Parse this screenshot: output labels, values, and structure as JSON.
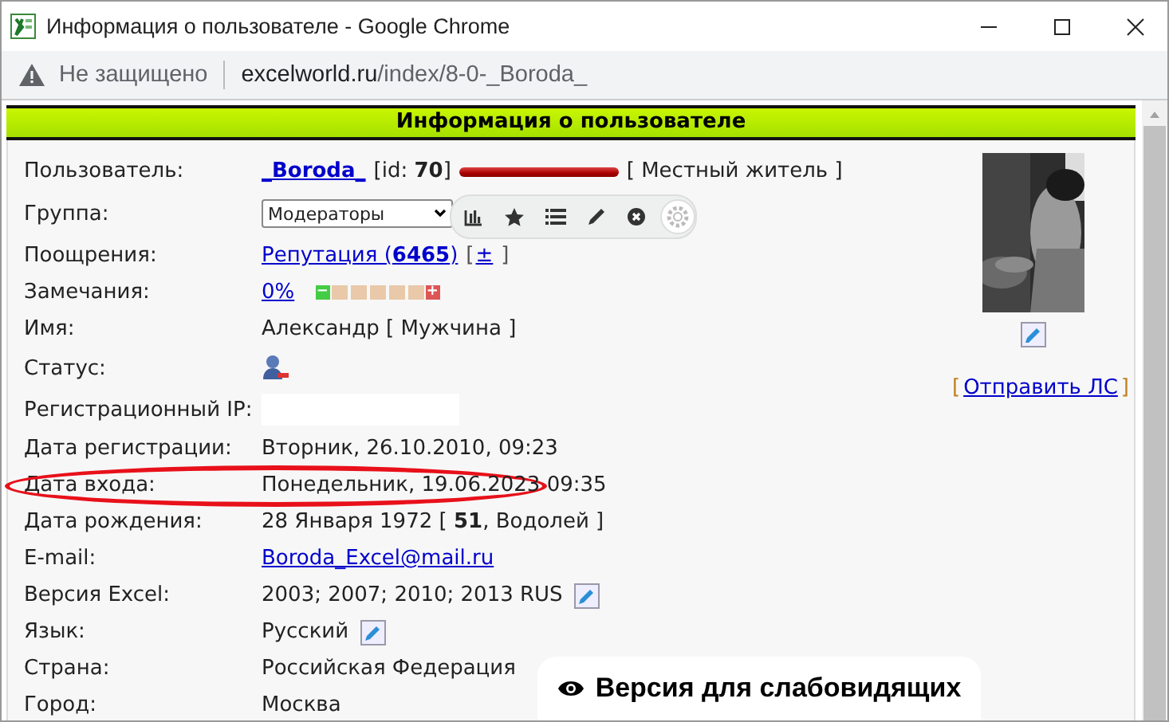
{
  "window": {
    "title": "Информация о пользователе - Google Chrome"
  },
  "address_bar": {
    "security": "Не защищено",
    "url_host": "excelworld.ru",
    "url_path": "/index/8-0-_Boroda_"
  },
  "panel": {
    "title": "Информация о пользователе"
  },
  "rows": [
    {
      "kind": "user",
      "label": "Пользователь:",
      "name": "_Boroda_",
      "id": "[id: **70**]",
      "rank": "[ Местный житель ]",
      "highlighted": false
    },
    {
      "kind": "select",
      "label": "Группа:",
      "value": "Модераторы",
      "highlighted": false
    },
    {
      "kind": "reputation",
      "label": "Поощрения:",
      "link": "Репутация (**6465**)",
      "open": "[",
      "action": "±",
      "close": "]",
      "highlighted": false
    },
    {
      "kind": "warnings",
      "label": "Замечания:",
      "link": "0%",
      "minus": "−",
      "plus": "+",
      "highlighted": false
    },
    {
      "kind": "text",
      "label": "Имя:",
      "value": "Александр [ Мужчина ]",
      "edit": false,
      "highlighted": false
    },
    {
      "kind": "status",
      "label": "Статус:",
      "online": false,
      "highlighted": false
    },
    {
      "kind": "ip",
      "label": "Регистрационный IP:",
      "highlighted": false
    },
    {
      "kind": "text",
      "label": "Дата регистрации:",
      "value": "Вторник, 26.10.2010, 09:23",
      "edit": false,
      "highlighted": false
    },
    {
      "kind": "text",
      "label": "Дата входа:",
      "value": "Понедельник, 19.06.2023 09:35",
      "edit": false,
      "highlighted": true
    },
    {
      "kind": "text",
      "label": "Дата рождения:",
      "value": "28 Января 1972 [ **51**, Водолей ]",
      "edit": false,
      "highlighted": false
    },
    {
      "kind": "email",
      "label": "E-mail:",
      "value": "Boroda_Excel@mail.ru",
      "highlighted": false
    },
    {
      "kind": "text",
      "label": "Версия Excel:",
      "value": "2003; 2007; 2010; 2013 RUS",
      "edit": true,
      "highlighted": false
    },
    {
      "kind": "text",
      "label": "Язык:",
      "value": "Русский",
      "edit": true,
      "highlighted": false
    },
    {
      "kind": "text",
      "label": "Страна:",
      "value": "Российская Федерация",
      "edit": false,
      "highlighted": false
    },
    {
      "kind": "text",
      "label": "Город:",
      "value": "Москва",
      "edit": false,
      "highlighted": false
    }
  ],
  "avatar": {
    "kind": "picture",
    "edit": true
  },
  "send_message": {
    "open": "[",
    "link": "Отправить ЛС",
    "close": "]"
  },
  "accessibility_button": "Версия для слабовидящих"
}
